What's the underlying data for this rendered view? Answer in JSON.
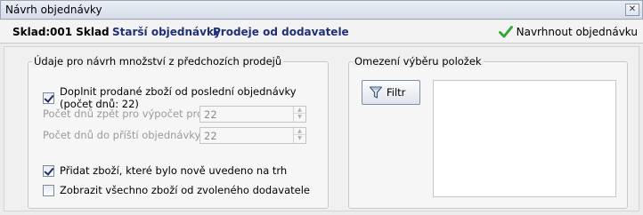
{
  "window": {
    "title": "Návrh objednávky",
    "close_glyph": "✕"
  },
  "toolbar": {
    "sklad_label": "Sklad:",
    "sklad_value": "001 Sklad",
    "older_orders_link": "Starší objednávky",
    "supplier_sales_link": "Prodeje od dodavatele",
    "suggest_button": "Navrhnout objednávku",
    "suggest_icon": "check-icon",
    "accent_color": "#1f2f7a",
    "check_color": "#2fa52f"
  },
  "left_group": {
    "legend": "Údaje pro návrh množství z předchozích prodejů",
    "add_sold": {
      "label": "Doplnit prodané zboží od poslední objednávky (počet dnů: 22)",
      "checked": true
    },
    "days_back": {
      "label": "Počet dnů zpět pro výpočet prodejů",
      "value": "22"
    },
    "days_next": {
      "label": "Počet dnů do příští objednávky",
      "value": "22"
    },
    "add_new": {
      "label": "Přidat zboží, které bylo nově uvedeno na trh",
      "checked": true
    },
    "show_all": {
      "label": "Zobrazit všechno zboží od zvoleného dodavatele",
      "checked": false
    }
  },
  "right_group": {
    "legend": "Omezení výběru položek",
    "filter_button": "Filtr",
    "filter_icon": "funnel-icon"
  }
}
